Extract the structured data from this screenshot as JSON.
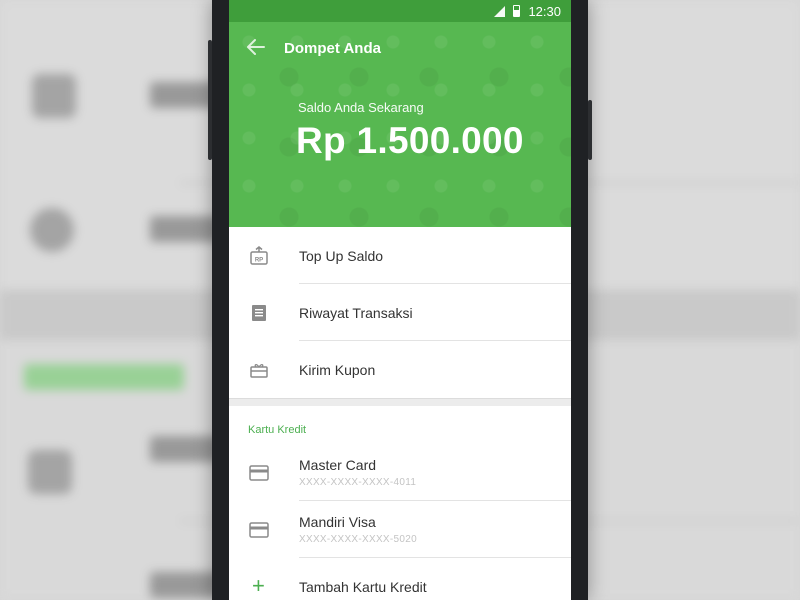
{
  "status_bar": {
    "time": "12:30"
  },
  "header": {
    "title": "Dompet Anda",
    "balance_label": "Saldo Anda Sekarang",
    "balance_value": "Rp 1.500.000"
  },
  "menu": {
    "items": [
      {
        "label": "Top Up Saldo",
        "icon": "topup-rp-icon"
      },
      {
        "label": "Riwayat Transaksi",
        "icon": "receipt-icon"
      },
      {
        "label": "Kirim Kupon",
        "icon": "gift-icon"
      }
    ]
  },
  "credit_cards": {
    "section_title": "Kartu Kredit",
    "cards": [
      {
        "name": "Master Card",
        "number": "XXXX-XXXX-XXXX-4011",
        "icon": "credit-card-icon"
      },
      {
        "name": "Mandiri Visa",
        "number": "XXXX-XXXX-XXXX-5020",
        "icon": "credit-card-icon"
      }
    ],
    "add_label": "Tambah Kartu Kredit"
  },
  "colors": {
    "primary_green": "#57b851",
    "status_bar_green": "#3f9e3b",
    "accent_green": "#4caf50"
  }
}
